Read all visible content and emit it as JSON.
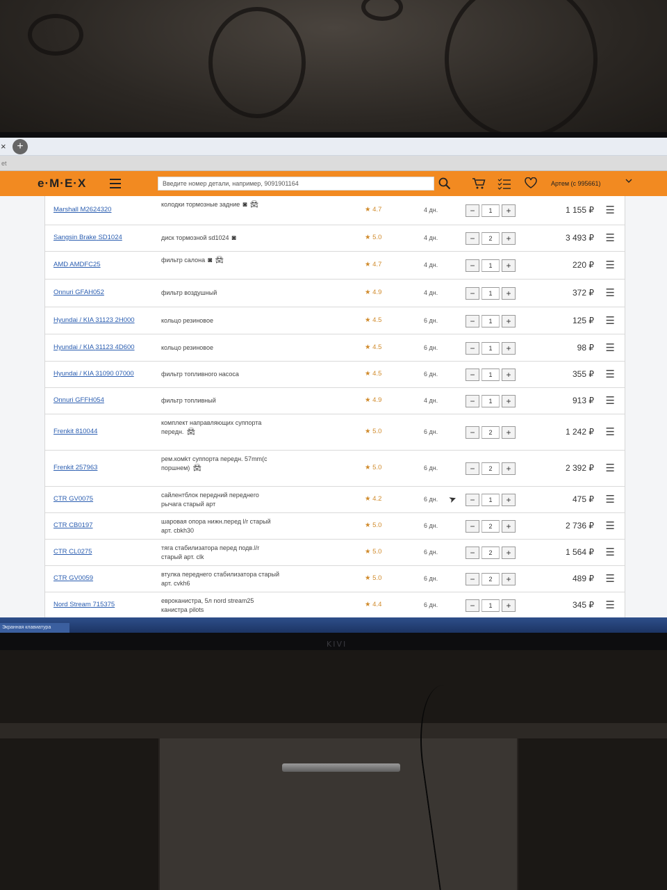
{
  "browser": {
    "close_glyph": "×",
    "add_glyph": "+",
    "address_fragment": "et"
  },
  "header": {
    "logo": "e·M·E·X",
    "search_placeholder": "Введите номер детали, например, 9091901164",
    "user": "Артем  (с 995661)",
    "accent_color": "#f28a21",
    "icons": [
      "search-icon",
      "cart-icon",
      "list-icon",
      "heart-icon",
      "chevron-down-icon"
    ]
  },
  "rows": [
    {
      "brand": "Marshall",
      "code": "M2624320",
      "desc": "колодки тормозные задние",
      "photo": true,
      "car": true,
      "rating": "4.7",
      "days": "4 дн.",
      "qty": "1",
      "price": "1 155 ₽"
    },
    {
      "brand": "Sangsin Brake",
      "code": "SD1024",
      "desc": "диск тормозной sd1024",
      "photo": true,
      "car": false,
      "rating": "5.0",
      "days": "4 дн.",
      "qty": "2",
      "price": "3 493 ₽"
    },
    {
      "brand": "AMD",
      "code": "AMDFC25",
      "desc": "фильтр салона",
      "photo": true,
      "car": true,
      "rating": "4.7",
      "days": "4 дн.",
      "qty": "1",
      "price": "220 ₽"
    },
    {
      "brand": "Onnuri",
      "code": "GFAH052",
      "desc": "фильтр воздушный",
      "photo": false,
      "car": false,
      "rating": "4.9",
      "days": "4 дн.",
      "qty": "1",
      "price": "372 ₽"
    },
    {
      "brand": "Hyundai / KIA",
      "code": "31123 2H000",
      "desc": "кольцо резиновое",
      "photo": false,
      "car": false,
      "rating": "4.5",
      "days": "6 дн.",
      "qty": "1",
      "price": "125 ₽"
    },
    {
      "brand": "Hyundai / KIA",
      "code": "31123 4D600",
      "desc": "кольцо резиновое",
      "photo": false,
      "car": false,
      "rating": "4.5",
      "days": "6 дн.",
      "qty": "1",
      "price": "98 ₽"
    },
    {
      "brand": "Hyundai / KIA",
      "code": "31090 07000",
      "desc": "фильтр топливного насоса",
      "photo": false,
      "car": false,
      "rating": "4.5",
      "days": "6 дн.",
      "qty": "1",
      "price": "355 ₽"
    },
    {
      "brand": "Onnuri",
      "code": "GFFH054",
      "desc": "фильтр топливный",
      "photo": false,
      "car": false,
      "rating": "4.9",
      "days": "4 дн.",
      "qty": "1",
      "price": "913 ₽"
    },
    {
      "brand": "Frenkit",
      "code": "810044",
      "desc": "комплект направляющих суппорта передн.",
      "photo": false,
      "car": true,
      "rating": "5.0",
      "days": "6 дн.",
      "qty": "2",
      "price": "1 242 ₽"
    },
    {
      "brand": "Frenkit",
      "code": "257963",
      "desc": "рем.комkт суппорта передн. 57mm(с поршнем)",
      "photo": false,
      "car": true,
      "rating": "5.0",
      "days": "6 дн.",
      "qty": "2",
      "price": "2 392 ₽"
    },
    {
      "brand": "CTR",
      "code": "GV0075",
      "desc": "сайлентблок передний переднего рычага старый арт",
      "photo": false,
      "car": false,
      "rating": "4.2",
      "days": "6 дн.",
      "qty": "1",
      "price": "475 ₽"
    },
    {
      "brand": "CTR",
      "code": "CB0197",
      "desc": "шаровая опора нижн.перед l/r старый арт. cbkh30",
      "photo": false,
      "car": false,
      "rating": "5.0",
      "days": "6 дн.",
      "qty": "2",
      "price": "2 736 ₽"
    },
    {
      "brand": "CTR",
      "code": "CL0275",
      "desc": "тяга стабилизатора перед подв.l/r старый арт. clk",
      "photo": false,
      "car": false,
      "rating": "5.0",
      "days": "6 дн.",
      "qty": "2",
      "price": "1 564 ₽"
    },
    {
      "brand": "CTR",
      "code": "GV0059",
      "desc": "втулка переднего стабилизатора старый арт. cvkh6",
      "photo": false,
      "car": false,
      "rating": "5.0",
      "days": "6 дн.",
      "qty": "2",
      "price": "489 ₽"
    },
    {
      "brand": "Nord Stream",
      "code": "715375",
      "desc": "евроканистра, 5л nord stream25 канистра pilots",
      "photo": false,
      "car": false,
      "rating": "4.4",
      "days": "6 дн.",
      "qty": "1",
      "price": "345 ₽"
    }
  ],
  "taskbar": {
    "item": "Экранная клавиатура"
  },
  "tv": {
    "brand": "KIVI"
  }
}
